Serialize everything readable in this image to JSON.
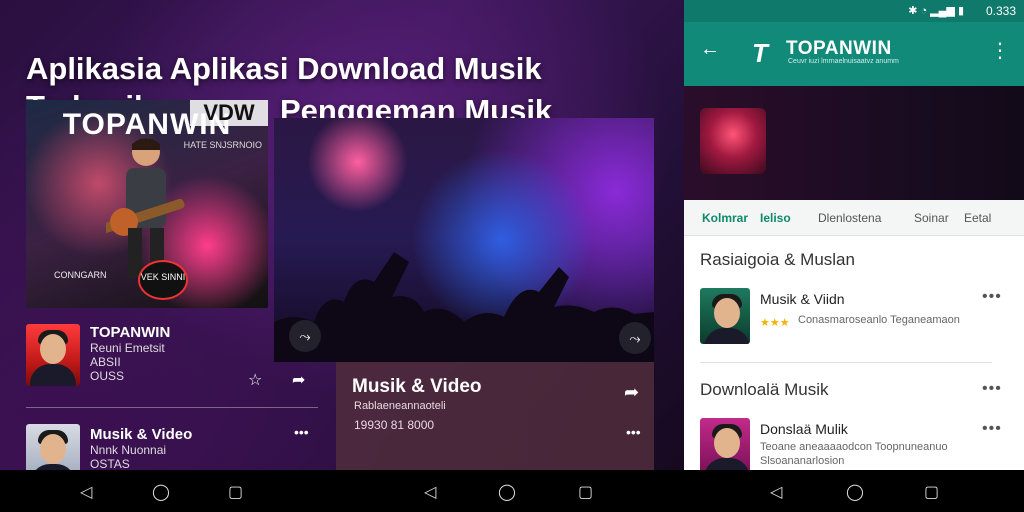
{
  "headline": {
    "line1": "Aplikasia Aplikasi Download Musik Terbaaik",
    "line2": "Penggeman Musik"
  },
  "album": {
    "title": "TOPANWIN",
    "overlay": "VDW",
    "sub": "HATE SNJSRNOIO",
    "caption": "CONNGARN",
    "badge": "VEK SINNI"
  },
  "list": {
    "item1": {
      "title": "TOPANWIN",
      "line1": "Reuni Emetsit",
      "line2": "ABSII",
      "line3": "OUSS"
    },
    "item2": {
      "title": "Musik & Video",
      "line1": "Nnnk Nuonnai",
      "line2": "OSTAS"
    }
  },
  "concert_card": {
    "title": "Musik & Video",
    "subtitle": "Rablaeneannaoteli",
    "count": "19930 81 8000"
  },
  "phone": {
    "status": {
      "time": "0.333"
    },
    "app_title": "TOPANWIN",
    "app_subtitle": "Ceuvr iuzi lmrnaelnuisaatvz anumm",
    "tabs": [
      "Kolmrar",
      "Ieliso",
      "Dlenlostena",
      "Soinar",
      "Eetal"
    ],
    "sections": {
      "s1": "Rasiaigoia & Muslan",
      "s2": "Downloalä Musik"
    },
    "items": [
      {
        "title": "Musik & Viidn",
        "meta": "Conasmaroseanlo Teganeamaon",
        "stars": "★★★"
      },
      {
        "title": "Donslaä Mulik",
        "meta1": "Teoane aneaaaaodcon Toopnuneanuo",
        "meta2": "Slsoananarlosion"
      }
    ]
  },
  "icons": {
    "back": "arrow-left-icon",
    "more": "more-vert-icon",
    "share": "share-icon",
    "play": "play-icon",
    "nav_back": "nav-back-icon",
    "nav_home": "nav-home-icon",
    "nav_recent": "nav-recent-icon"
  },
  "colors": {
    "teal": "#128a7a",
    "accent_green": "#0f8a6b",
    "star": "#f2b400"
  }
}
